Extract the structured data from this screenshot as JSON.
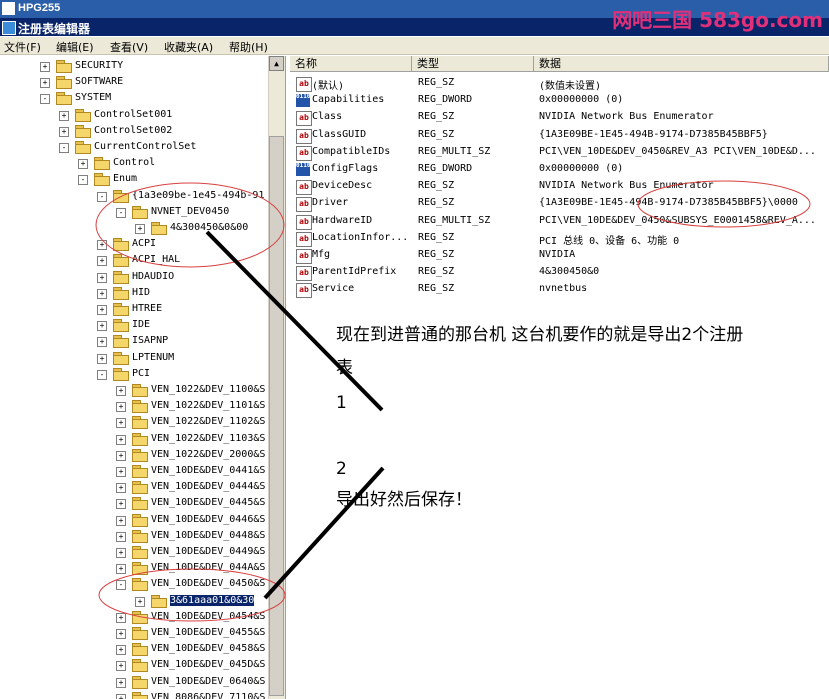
{
  "window": {
    "outer_title": "HPG255",
    "title": "注册表编辑器",
    "watermark": "网吧三国 583go.com"
  },
  "menu": [
    "文件(F)",
    "编辑(E)",
    "查看(V)",
    "收藏夹(A)",
    "帮助(H)"
  ],
  "tree": [
    {
      "label": "SECURITY",
      "expander": "+",
      "depth": 2
    },
    {
      "label": "SOFTWARE",
      "expander": "+",
      "depth": 2
    },
    {
      "label": "SYSTEM",
      "expander": "-",
      "depth": 2
    },
    {
      "label": "ControlSet001",
      "expander": "+",
      "depth": 3
    },
    {
      "label": "ControlSet002",
      "expander": "+",
      "depth": 3
    },
    {
      "label": "CurrentControlSet",
      "expander": "-",
      "depth": 3
    },
    {
      "label": "Control",
      "expander": "+",
      "depth": 4
    },
    {
      "label": "Enum",
      "expander": "-",
      "depth": 4
    },
    {
      "label": "{1a3e09be-1e45-494b-91",
      "expander": "-",
      "depth": 5
    },
    {
      "label": "NVNET_DEV0450",
      "expander": "-",
      "depth": 6
    },
    {
      "label": "4&300450&0&00",
      "expander": "+",
      "depth": 7
    },
    {
      "label": "ACPI",
      "expander": "+",
      "depth": 5
    },
    {
      "label": "ACPI_HAL",
      "expander": "+",
      "depth": 5
    },
    {
      "label": "HDAUDIO",
      "expander": "+",
      "depth": 5
    },
    {
      "label": "HID",
      "expander": "+",
      "depth": 5
    },
    {
      "label": "HTREE",
      "expander": "+",
      "depth": 5
    },
    {
      "label": "IDE",
      "expander": "+",
      "depth": 5
    },
    {
      "label": "ISAPNP",
      "expander": "+",
      "depth": 5
    },
    {
      "label": "LPTENUM",
      "expander": "+",
      "depth": 5
    },
    {
      "label": "PCI",
      "expander": "-",
      "depth": 5
    },
    {
      "label": "VEN_1022&DEV_1100&S",
      "expander": "+",
      "depth": 6
    },
    {
      "label": "VEN_1022&DEV_1101&S",
      "expander": "+",
      "depth": 6
    },
    {
      "label": "VEN_1022&DEV_1102&S",
      "expander": "+",
      "depth": 6
    },
    {
      "label": "VEN_1022&DEV_1103&S",
      "expander": "+",
      "depth": 6
    },
    {
      "label": "VEN_1022&DEV_2000&S",
      "expander": "+",
      "depth": 6
    },
    {
      "label": "VEN_10DE&DEV_0441&S",
      "expander": "+",
      "depth": 6
    },
    {
      "label": "VEN_10DE&DEV_0444&S",
      "expander": "+",
      "depth": 6
    },
    {
      "label": "VEN_10DE&DEV_0445&S",
      "expander": "+",
      "depth": 6
    },
    {
      "label": "VEN_10DE&DEV_0446&S",
      "expander": "+",
      "depth": 6
    },
    {
      "label": "VEN_10DE&DEV_0448&S",
      "expander": "+",
      "depth": 6
    },
    {
      "label": "VEN_10DE&DEV_0449&S",
      "expander": "+",
      "depth": 6
    },
    {
      "label": "VEN_10DE&DEV_044A&S",
      "expander": "+",
      "depth": 6
    },
    {
      "label": "VEN_10DE&DEV_0450&S",
      "expander": "-",
      "depth": 6
    },
    {
      "label": "3&61aaa01&0&30",
      "expander": "+",
      "depth": 7,
      "selected": true
    },
    {
      "label": "VEN_10DE&DEV_0454&S",
      "expander": "+",
      "depth": 6
    },
    {
      "label": "VEN_10DE&DEV_0455&S",
      "expander": "+",
      "depth": 6
    },
    {
      "label": "VEN_10DE&DEV_0458&S",
      "expander": "+",
      "depth": 6
    },
    {
      "label": "VEN_10DE&DEV_045D&S",
      "expander": "+",
      "depth": 6
    },
    {
      "label": "VEN_10DE&DEV_0640&S",
      "expander": "+",
      "depth": 6
    },
    {
      "label": "VEN_8086&DEV_7110&S",
      "expander": "+",
      "depth": 6
    }
  ],
  "list": {
    "headers": [
      "名称",
      "类型",
      "数据"
    ],
    "rows": [
      {
        "name": "(默认)",
        "type": "REG_SZ",
        "data": "(数值未设置)",
        "icon": "string-value-icon"
      },
      {
        "name": "Capabilities",
        "type": "REG_DWORD",
        "data": "0x00000000 (0)",
        "icon": "binary-value-icon"
      },
      {
        "name": "Class",
        "type": "REG_SZ",
        "data": "NVIDIA Network Bus Enumerator",
        "icon": "string-value-icon"
      },
      {
        "name": "ClassGUID",
        "type": "REG_SZ",
        "data": "{1A3E09BE-1E45-494B-9174-D7385B45BBF5}",
        "icon": "string-value-icon"
      },
      {
        "name": "CompatibleIDs",
        "type": "REG_MULTI_SZ",
        "data": "PCI\\VEN_10DE&DEV_0450&REV_A3 PCI\\VEN_10DE&D...",
        "icon": "string-value-icon"
      },
      {
        "name": "ConfigFlags",
        "type": "REG_DWORD",
        "data": "0x00000000 (0)",
        "icon": "binary-value-icon"
      },
      {
        "name": "DeviceDesc",
        "type": "REG_SZ",
        "data": "NVIDIA Network Bus Enumerator",
        "icon": "string-value-icon"
      },
      {
        "name": "Driver",
        "type": "REG_SZ",
        "data": "{1A3E09BE-1E45-494B-9174-D7385B45BBF5}\\0000",
        "icon": "string-value-icon"
      },
      {
        "name": "HardwareID",
        "type": "REG_MULTI_SZ",
        "data": "PCI\\VEN_10DE&DEV_0450&SUBSYS_E0001458&REV_A...",
        "icon": "string-value-icon"
      },
      {
        "name": "LocationInfor...",
        "type": "REG_SZ",
        "data": "PCI 总线 0、设备 6、功能 0",
        "icon": "string-value-icon"
      },
      {
        "name": "Mfg",
        "type": "REG_SZ",
        "data": "NVIDIA",
        "icon": "string-value-icon"
      },
      {
        "name": "ParentIdPrefix",
        "type": "REG_SZ",
        "data": "4&300450&0",
        "icon": "string-value-icon"
      },
      {
        "name": "Service",
        "type": "REG_SZ",
        "data": "nvnetbus",
        "icon": "string-value-icon"
      }
    ]
  },
  "annotation": {
    "line1": "现在到进普通的那台机 这台机要作的就是导出2个注册",
    "line2": "表",
    "mark1": "1",
    "mark2": "2",
    "line3": "导出好然后保存！"
  }
}
